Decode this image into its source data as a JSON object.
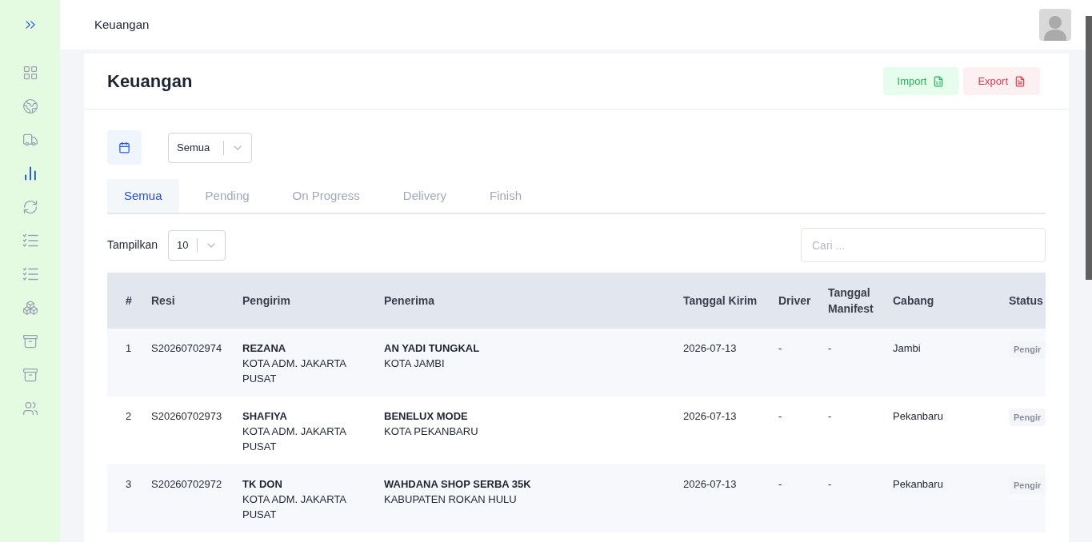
{
  "sidebar": {
    "items": [
      {
        "kind": "expand",
        "selected": false
      },
      {
        "kind": "grid",
        "selected": false
      },
      {
        "kind": "globe",
        "selected": false
      },
      {
        "kind": "truck",
        "selected": false
      },
      {
        "kind": "chart",
        "selected": true
      },
      {
        "kind": "refresh",
        "selected": false
      },
      {
        "kind": "checklist",
        "selected": false
      },
      {
        "kind": "checklist",
        "selected": false
      },
      {
        "kind": "boxes",
        "selected": false
      },
      {
        "kind": "archive",
        "selected": false
      },
      {
        "kind": "archive",
        "selected": false
      },
      {
        "kind": "users",
        "selected": false
      }
    ]
  },
  "header": {
    "title": "Keuangan"
  },
  "page": {
    "title": "Keuangan",
    "buttons": [
      {
        "kind": "import",
        "label": "Import"
      },
      {
        "kind": "export",
        "label": "Export"
      }
    ]
  },
  "filter": {
    "status_select": "Semua"
  },
  "tabs": [
    {
      "label": "Semua",
      "selected": true
    },
    {
      "label": "Pending",
      "selected": false
    },
    {
      "label": "On Progress",
      "selected": false
    },
    {
      "label": "Delivery",
      "selected": false
    },
    {
      "label": "Finish",
      "selected": false
    }
  ],
  "length": {
    "label": "Tampilkan",
    "value": "10"
  },
  "search": {
    "placeholder": "Cari ..."
  },
  "table": {
    "columns": [
      "#",
      "Resi",
      "Pengirim",
      "Penerima",
      "Tanggal Kirim",
      "Driver",
      "Tanggal Manifest",
      "Cabang",
      "Status"
    ],
    "rows": [
      {
        "no": "1",
        "resi": "S20260702974",
        "sender": "REZANA",
        "sender_city": "KOTA ADM. JAKARTA PUSAT",
        "receiver": "AN YADI TUNGKAL",
        "receiver_city": "KOTA JAMBI",
        "date": "2026-07-13",
        "driver": "-",
        "manifest": "-",
        "branch": "Jambi",
        "status": "Pengir"
      },
      {
        "no": "2",
        "resi": "S20260702973",
        "sender": "SHAFIYA",
        "sender_city": "KOTA ADM. JAKARTA PUSAT",
        "receiver": "BENELUX MODE",
        "receiver_city": "KOTA PEKANBARU",
        "date": "2026-07-13",
        "driver": "-",
        "manifest": "-",
        "branch": "Pekanbaru",
        "status": "Pengir"
      },
      {
        "no": "3",
        "resi": "S20260702972",
        "sender": "TK DON",
        "sender_city": "KOTA ADM. JAKARTA PUSAT",
        "receiver": "WAHDANA SHOP SERBA 35K",
        "receiver_city": "KABUPATEN ROKAN HULU",
        "date": "2026-07-13",
        "driver": "-",
        "manifest": "-",
        "branch": "Pekanbaru",
        "status": "Pengir"
      }
    ]
  }
}
